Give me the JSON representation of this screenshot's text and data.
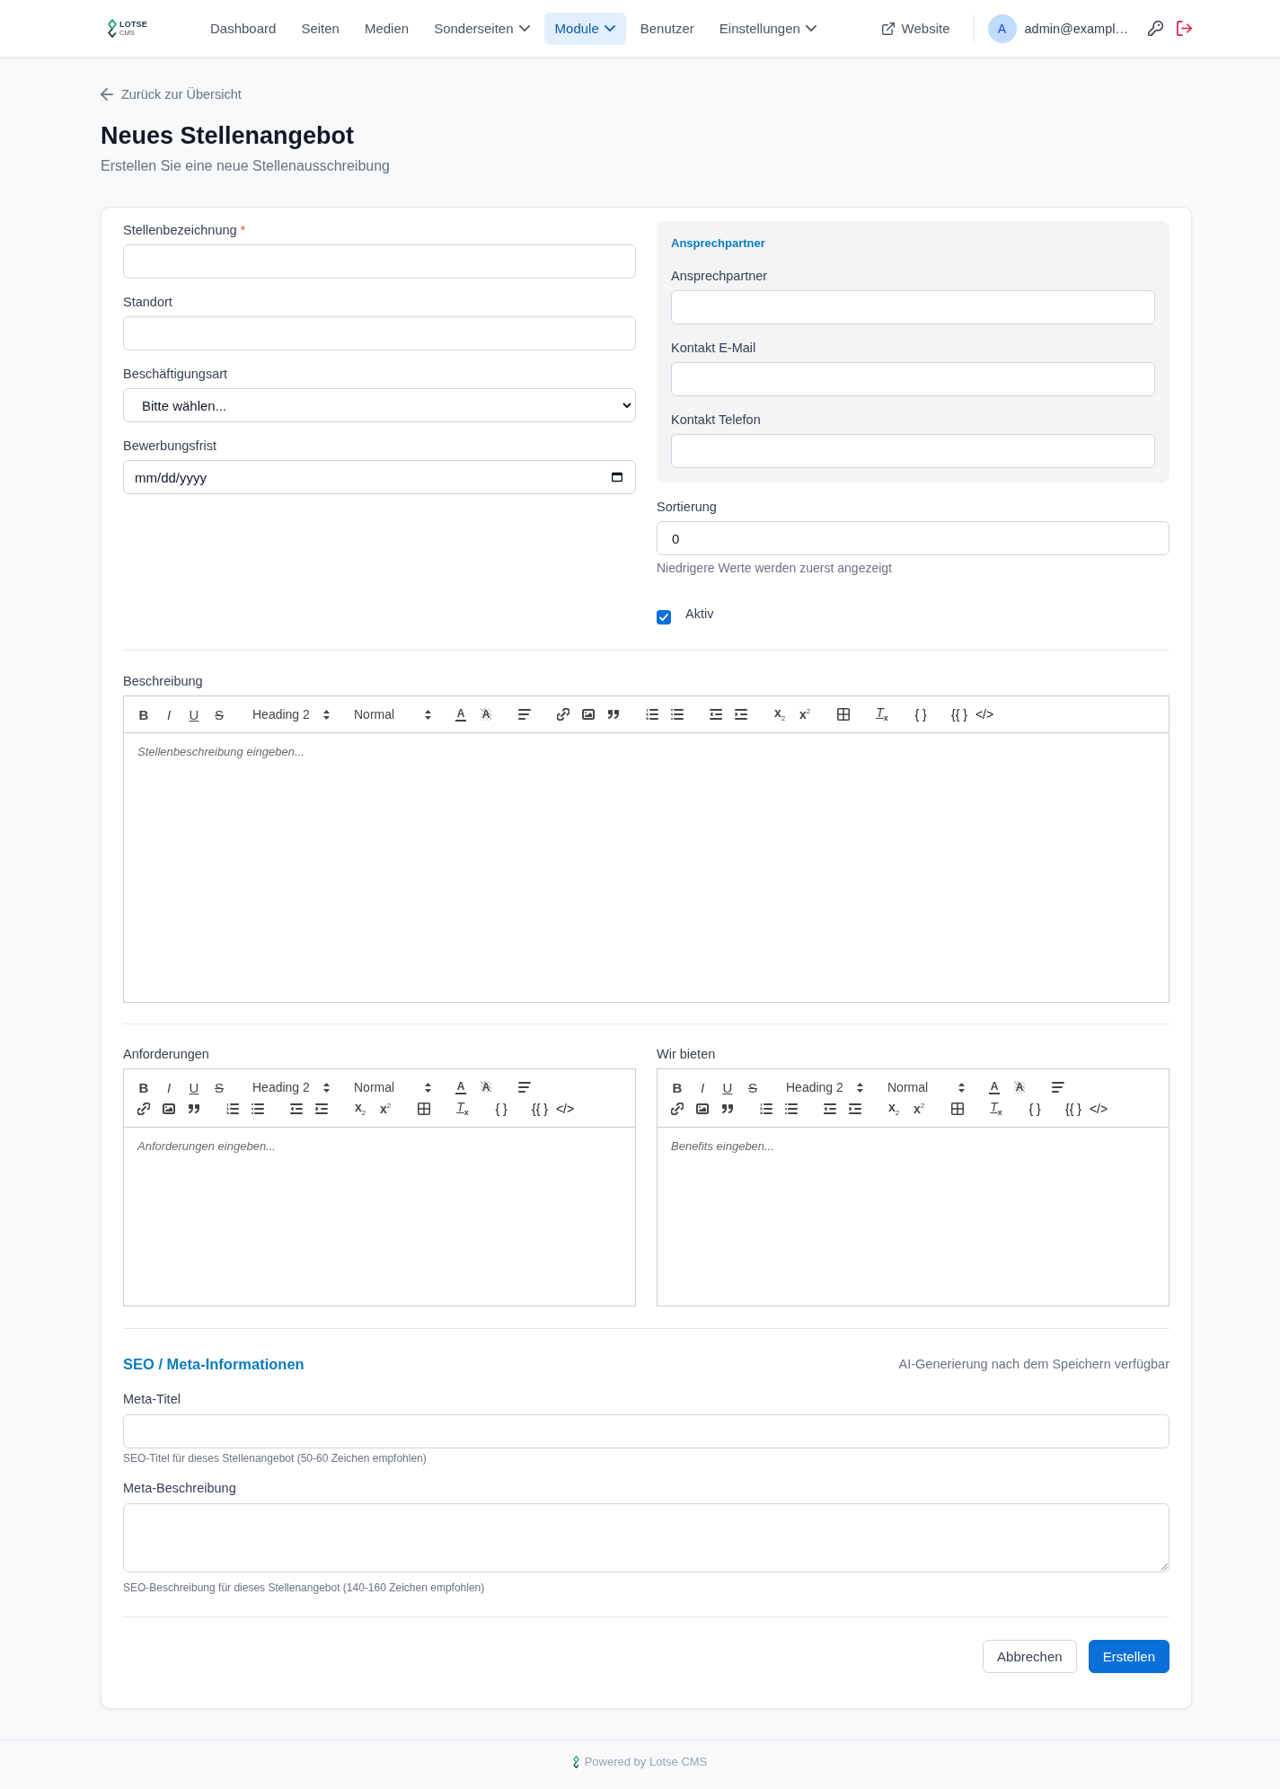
{
  "header": {
    "logo": {
      "name": "LOTSE",
      "tagline": "CMS"
    },
    "nav": [
      {
        "label": "Dashboard",
        "selected": false,
        "dropdown": false
      },
      {
        "label": "Seiten",
        "selected": false,
        "dropdown": false
      },
      {
        "label": "Medien",
        "selected": false,
        "dropdown": false
      },
      {
        "label": "Sonderseiten",
        "selected": false,
        "dropdown": true
      },
      {
        "label": "Module",
        "selected": true,
        "dropdown": true
      },
      {
        "label": "Benutzer",
        "selected": false,
        "dropdown": false
      },
      {
        "label": "Einstellungen",
        "selected": false,
        "dropdown": true
      }
    ],
    "website_link": "Website",
    "user": {
      "initial": "A",
      "email": "admin@exampl…"
    }
  },
  "back_link": "Zurück zur Übersicht",
  "page_title": "Neues Stellenangebot",
  "page_subtitle": "Erstellen Sie eine neue Stellenausschreibung",
  "form": {
    "main_fields": [
      {
        "kind": "text",
        "label": "Stellenbezeichnung",
        "required_mark": "*"
      },
      {
        "kind": "text",
        "label": "Standort"
      },
      {
        "kind": "select",
        "label": "Beschäftigungsart",
        "value": "Bitte wählen..."
      },
      {
        "kind": "date",
        "label": "Bewerbungsfrist",
        "placeholder": "mm/dd/yyyy"
      }
    ],
    "contact_panel": {
      "title": "Ansprechpartner",
      "fields": [
        {
          "label": "Ansprechpartner"
        },
        {
          "label": "Kontakt E-Mail"
        },
        {
          "label": "Kontakt Telefon"
        }
      ]
    },
    "sort_field": {
      "label": "Sortierung",
      "value": "0",
      "hint": "Niedrigere Werte werden zuerst angezeigt"
    },
    "active_checkbox": {
      "label": "Aktiv",
      "checked": true
    },
    "description_editor": {
      "label": "Beschreibung",
      "placeholder": "Stellenbeschreibung eingeben...",
      "toolbar": [
        [
          {
            "kind": "bold",
            "label": "B"
          },
          {
            "kind": "italic",
            "label": "I"
          },
          {
            "kind": "underline",
            "label": "U"
          },
          {
            "kind": "strike",
            "label": "S"
          }
        ],
        [
          {
            "kind": "picker",
            "label": "Heading 2"
          }
        ],
        [
          {
            "kind": "picker",
            "label": "Normal"
          }
        ],
        [
          {
            "kind": "color",
            "label": "A"
          },
          {
            "kind": "background",
            "label": "A"
          }
        ],
        [
          {
            "kind": "align"
          }
        ],
        [
          {
            "kind": "link"
          },
          {
            "kind": "image"
          },
          {
            "kind": "quote"
          }
        ],
        [
          {
            "kind": "ordered"
          },
          {
            "kind": "bullet"
          }
        ],
        [
          {
            "kind": "outdent"
          },
          {
            "kind": "indent"
          }
        ],
        [
          {
            "kind": "subscript",
            "label": "x$_{2}$"
          },
          {
            "kind": "superscript",
            "label": "x$^{2}$"
          }
        ],
        [
          {
            "kind": "table"
          }
        ],
        [
          {
            "kind": "clean",
            "label": "T$_{x}$"
          }
        ],
        [
          {
            "kind": "braces",
            "label": "{ }"
          }
        ],
        [
          {
            "kind": "template",
            "label": "{{ }"
          },
          {
            "kind": "html",
            "label": "</>"
          }
        ]
      ]
    },
    "side_editors": [
      {
        "label": "Anforderungen",
        "placeholder": "Anforderungen eingeben...",
        "toolbar": [
          [
            {
              "kind": "bold",
              "label": "B"
            },
            {
              "kind": "italic",
              "label": "I"
            },
            {
              "kind": "underline",
              "label": "U"
            },
            {
              "kind": "strike",
              "label": "S"
            }
          ],
          [
            {
              "kind": "picker",
              "label": "Heading 2"
            }
          ],
          [
            {
              "kind": "picker",
              "label": "Normal"
            }
          ],
          [
            {
              "kind": "color",
              "label": "A"
            },
            {
              "kind": "background",
              "label": "A"
            }
          ],
          [
            {
              "kind": "align"
            }
          ],
          [
            {
              "kind": "link"
            },
            {
              "kind": "image"
            },
            {
              "kind": "quote"
            }
          ],
          [
            {
              "kind": "ordered"
            },
            {
              "kind": "bullet"
            }
          ],
          [
            {
              "kind": "outdent"
            },
            {
              "kind": "indent"
            }
          ],
          [
            {
              "kind": "subscript",
              "label": "x$_{2}$"
            },
            {
              "kind": "superscript",
              "label": "x$^{2}$"
            }
          ],
          [
            {
              "kind": "table"
            }
          ],
          [
            {
              "kind": "clean",
              "label": "T$_{x}$"
            }
          ],
          [
            {
              "kind": "braces",
              "label": "{ }"
            }
          ],
          [
            {
              "kind": "template",
              "label": "{{ }"
            },
            {
              "kind": "html",
              "label": "</>"
            }
          ]
        ]
      },
      {
        "label": "Wir bieten",
        "placeholder": "Benefits eingeben...",
        "toolbar": [
          [
            {
              "kind": "bold",
              "label": "B"
            },
            {
              "kind": "italic",
              "label": "I"
            },
            {
              "kind": "underline",
              "label": "U"
            },
            {
              "kind": "strike",
              "label": "S"
            }
          ],
          [
            {
              "kind": "picker",
              "label": "Heading 2"
            }
          ],
          [
            {
              "kind": "picker",
              "label": "Normal"
            }
          ],
          [
            {
              "kind": "color",
              "label": "A"
            },
            {
              "kind": "background",
              "label": "A"
            }
          ],
          [
            {
              "kind": "align"
            }
          ],
          [
            {
              "kind": "link"
            },
            {
              "kind": "image"
            },
            {
              "kind": "quote"
            }
          ],
          [
            {
              "kind": "ordered"
            },
            {
              "kind": "bullet"
            }
          ],
          [
            {
              "kind": "outdent"
            },
            {
              "kind": "indent"
            }
          ],
          [
            {
              "kind": "subscript",
              "label": "x$_{2}$"
            },
            {
              "kind": "superscript",
              "label": "x$^{2}$"
            }
          ],
          [
            {
              "kind": "table"
            }
          ],
          [
            {
              "kind": "clean",
              "label": "T$_{x}$"
            }
          ],
          [
            {
              "kind": "braces",
              "label": "{ }"
            }
          ],
          [
            {
              "kind": "template",
              "label": "{{ }"
            },
            {
              "kind": "html",
              "label": "</>"
            }
          ]
        ]
      }
    ],
    "seo": {
      "title": "SEO / Meta-Informationen",
      "note": "AI-Generierung nach dem Speichern verfügbar",
      "fields": [
        {
          "kind": "input",
          "label": "Meta-Titel",
          "hint": "SEO-Titel für dieses Stellenangebot (50-60 Zeichen empfohlen)"
        },
        {
          "kind": "textarea",
          "label": "Meta-Beschreibung",
          "hint": "SEO-Beschreibung für dieses Stellenangebot (140-160 Zeichen empfohlen)"
        }
      ]
    },
    "actions": [
      {
        "kind": "secondary",
        "label": "Abbrechen"
      },
      {
        "kind": "primary",
        "label": "Erstellen"
      }
    ]
  },
  "footer": {
    "text": "Powered by Lotse CMS"
  }
}
